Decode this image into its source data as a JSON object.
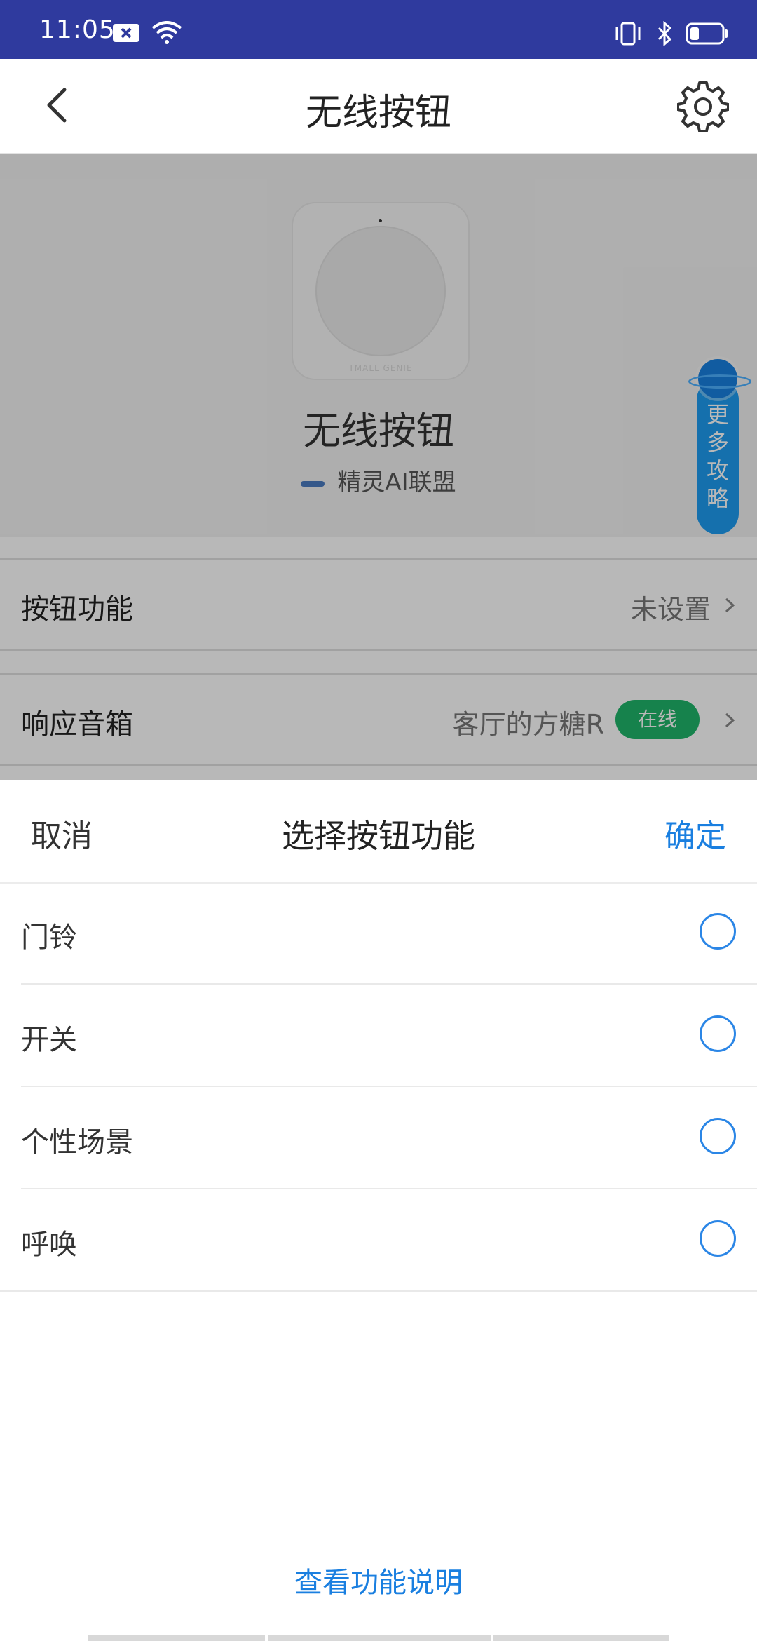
{
  "status_bar": {
    "time": "11:05"
  },
  "header": {
    "title": "无线按钮"
  },
  "product": {
    "image_brand": "TMALL GENIE",
    "name": "无线按钮",
    "manufacturer": "精灵AI联盟"
  },
  "more_tips": {
    "chars": [
      "更",
      "多",
      "攻",
      "略"
    ]
  },
  "rows": {
    "button_function": {
      "label": "按钮功能",
      "value": "未设置"
    },
    "speaker": {
      "label": "响应音箱",
      "value": "客厅的方糖R",
      "badge": "在线"
    }
  },
  "sheet": {
    "cancel": "取消",
    "title": "选择按钮功能",
    "confirm": "确定",
    "options": [
      {
        "label": "门铃"
      },
      {
        "label": "开关"
      },
      {
        "label": "个性场景"
      },
      {
        "label": "呼唤"
      }
    ],
    "help_link": "查看功能说明"
  },
  "colors": {
    "status_bar": "#2f3a9e",
    "accent": "#1a7fe0",
    "online": "#1fb56a",
    "tips_button": "#1e9cf0"
  }
}
